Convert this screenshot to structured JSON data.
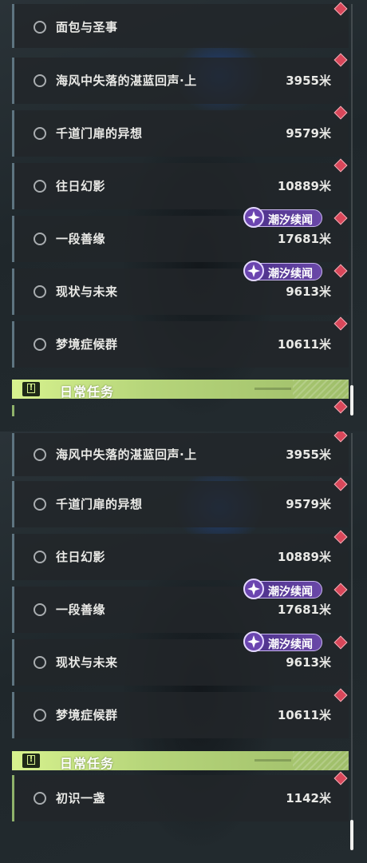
{
  "panel_top": {
    "quests": [
      {
        "name": "面包与圣事",
        "distance": "",
        "badge": false
      },
      {
        "name": "海风中失落的湛蓝回声·上",
        "distance": "3955米",
        "badge": false
      },
      {
        "name": "千道门扉的异想",
        "distance": "9579米",
        "badge": false
      },
      {
        "name": "往日幻影",
        "distance": "10889米",
        "badge": false
      },
      {
        "name": "一段善缘",
        "distance": "17681米",
        "badge": true
      },
      {
        "name": "现状与未来",
        "distance": "9613米",
        "badge": true
      },
      {
        "name": "梦境症候群",
        "distance": "10611米",
        "badge": false
      }
    ],
    "section_title": "日常任务"
  },
  "panel_bottom": {
    "quests": [
      {
        "name": "海风中失落的湛蓝回声·上",
        "distance": "3955米",
        "badge": false
      },
      {
        "name": "千道门扉的异想",
        "distance": "9579米",
        "badge": false
      },
      {
        "name": "往日幻影",
        "distance": "10889米",
        "badge": false
      },
      {
        "name": "一段善缘",
        "distance": "17681米",
        "badge": true
      },
      {
        "name": "现状与未来",
        "distance": "9613米",
        "badge": true
      },
      {
        "name": "梦境症候群",
        "distance": "10611米",
        "badge": false
      }
    ],
    "section_title": "日常任务",
    "daily_quests": [
      {
        "name": "初识一盏",
        "distance": "1142米"
      }
    ]
  },
  "badge_label": "潮汐续闻",
  "icons": {
    "status": "radio-circle-icon",
    "track": "diamond-marker-icon",
    "badge": "tide-sparkle-icon",
    "section": "alert-exclamation-icon"
  },
  "colors": {
    "accent_green": "#c8e484",
    "track_red": "#d9475a",
    "badge_purple": "#5a3a98",
    "row_border": "#5e7480"
  }
}
